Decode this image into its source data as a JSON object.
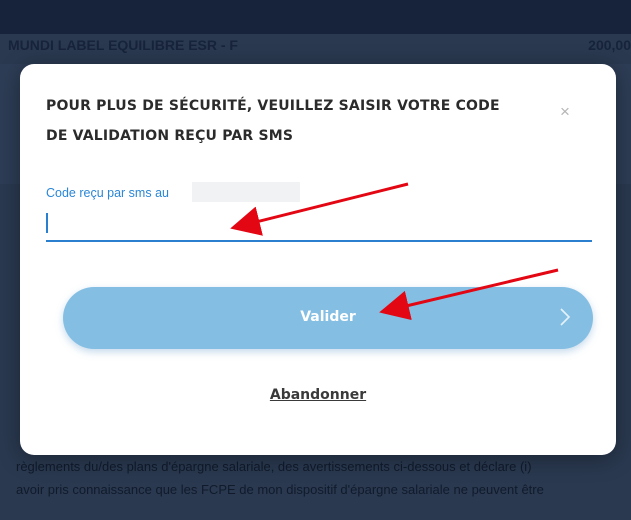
{
  "background": {
    "fund_name": "MUNDI LABEL EQUILIBRE ESR - F",
    "fund_amount": "200,00",
    "legal_lines": [
      "règlements du/des plans d'épargne salariale, des avertissements ci-dessous et déclare (i)",
      "avoir pris connaissance que les FCPE de mon dispositif d'épargne salariale ne peuvent être",
      ""
    ]
  },
  "modal": {
    "title": "POUR PLUS DE SÉCURITÉ, VEUILLEZ SAISIR VOTRE CODE DE VALIDATION REÇU PAR SMS",
    "close_symbol": "×",
    "code_label": "Code reçu par sms au",
    "code_value": "",
    "submit_label": "Valider",
    "cancel_label": "Abandonner"
  },
  "colors": {
    "accent": "#2b7fcf",
    "button": "#84bfe3",
    "annotation_arrow": "#e30613"
  }
}
